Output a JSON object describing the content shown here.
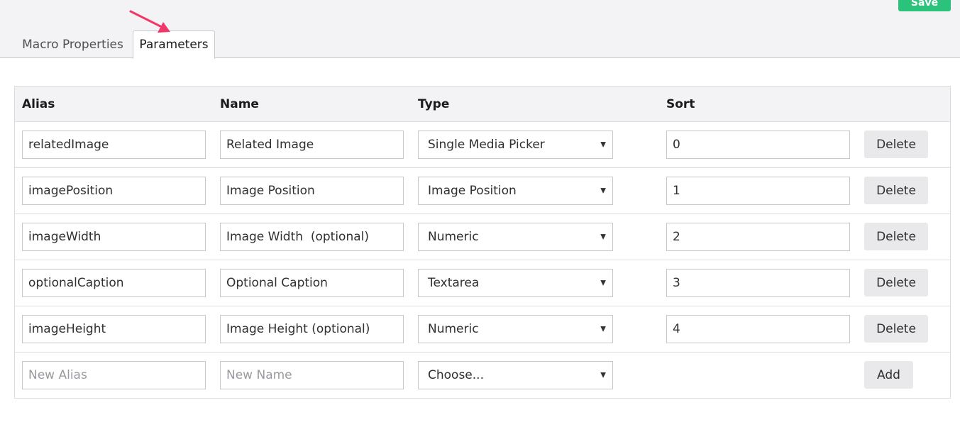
{
  "header": {
    "save_label": "Save",
    "tabs": [
      {
        "label": "Macro Properties",
        "active": false
      },
      {
        "label": "Parameters",
        "active": true
      }
    ]
  },
  "table": {
    "columns": [
      "Alias",
      "Name",
      "Type",
      "Sort"
    ],
    "rows": [
      {
        "alias": "relatedImage",
        "name": "Related Image",
        "type": "Single Media Picker",
        "sort": "0",
        "action": "Delete"
      },
      {
        "alias": "imagePosition",
        "name": "Image Position",
        "type": "Image Position",
        "sort": "1",
        "action": "Delete"
      },
      {
        "alias": "imageWidth",
        "name": "Image Width  (optional)",
        "type": "Numeric",
        "sort": "2",
        "action": "Delete"
      },
      {
        "alias": "optionalCaption",
        "name": "Optional Caption",
        "type": "Textarea",
        "sort": "3",
        "action": "Delete"
      },
      {
        "alias": "imageHeight",
        "name": "Image Height (optional)",
        "type": "Numeric",
        "sort": "4",
        "action": "Delete"
      }
    ],
    "new_row": {
      "alias_placeholder": "New Alias",
      "name_placeholder": "New Name",
      "type": "Choose...",
      "action": "Add"
    }
  },
  "colors": {
    "save": "#2bc37c",
    "arrow": "#f0386b"
  }
}
